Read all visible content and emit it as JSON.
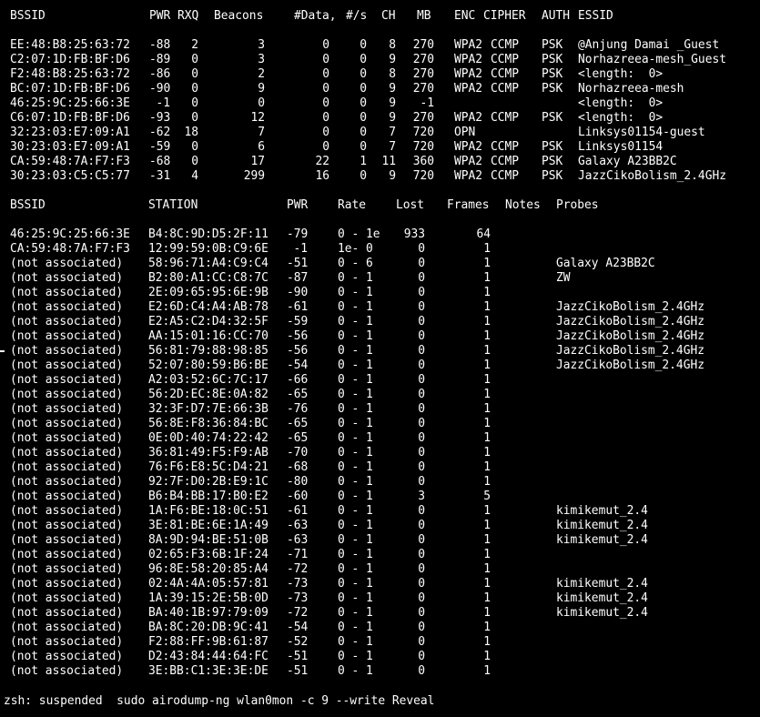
{
  "ap_table": {
    "headers": {
      "bssid": "BSSID",
      "pwr": "PWR",
      "rxq": "RXQ",
      "beacons": "Beacons",
      "data": "#Data,",
      "per_s": "#/s",
      "ch": "CH",
      "mb": "MB",
      "enc": "ENC",
      "cipher": "CIPHER",
      "auth": "AUTH",
      "essid": "ESSID"
    },
    "rows": [
      {
        "bssid": "EE:48:B8:25:63:72",
        "pwr": "-88",
        "rxq": "2",
        "beacons": "3",
        "data": "0",
        "per_s": "0",
        "ch": "8",
        "mb": "270",
        "enc": "WPA2",
        "cipher": "CCMP",
        "auth": "PSK",
        "essid": "@Anjung Damai _Guest"
      },
      {
        "bssid": "C2:07:1D:FB:BF:D6",
        "pwr": "-89",
        "rxq": "0",
        "beacons": "3",
        "data": "0",
        "per_s": "0",
        "ch": "9",
        "mb": "270",
        "enc": "WPA2",
        "cipher": "CCMP",
        "auth": "PSK",
        "essid": "Norhazreea-mesh_Guest"
      },
      {
        "bssid": "F2:48:B8:25:63:72",
        "pwr": "-86",
        "rxq": "0",
        "beacons": "2",
        "data": "0",
        "per_s": "0",
        "ch": "8",
        "mb": "270",
        "enc": "WPA2",
        "cipher": "CCMP",
        "auth": "PSK",
        "essid": "<length:  0>"
      },
      {
        "bssid": "BC:07:1D:FB:BF:D6",
        "pwr": "-90",
        "rxq": "0",
        "beacons": "9",
        "data": "0",
        "per_s": "0",
        "ch": "9",
        "mb": "270",
        "enc": "WPA2",
        "cipher": "CCMP",
        "auth": "PSK",
        "essid": "Norhazreea-mesh"
      },
      {
        "bssid": "46:25:9C:25:66:3E",
        "pwr": "-1",
        "rxq": "0",
        "beacons": "0",
        "data": "0",
        "per_s": "0",
        "ch": "9",
        "mb": "-1",
        "enc": "",
        "cipher": "",
        "auth": "",
        "essid": "<length:  0>"
      },
      {
        "bssid": "C6:07:1D:FB:BF:D6",
        "pwr": "-93",
        "rxq": "0",
        "beacons": "12",
        "data": "0",
        "per_s": "0",
        "ch": "9",
        "mb": "270",
        "enc": "WPA2",
        "cipher": "CCMP",
        "auth": "PSK",
        "essid": "<length:  0>"
      },
      {
        "bssid": "32:23:03:E7:09:A1",
        "pwr": "-62",
        "rxq": "18",
        "beacons": "7",
        "data": "0",
        "per_s": "0",
        "ch": "7",
        "mb": "720",
        "enc": "OPN",
        "cipher": "",
        "auth": "",
        "essid": "Linksys01154-guest"
      },
      {
        "bssid": "30:23:03:E7:09:A1",
        "pwr": "-59",
        "rxq": "0",
        "beacons": "6",
        "data": "0",
        "per_s": "0",
        "ch": "7",
        "mb": "720",
        "enc": "WPA2",
        "cipher": "CCMP",
        "auth": "PSK",
        "essid": "Linksys01154"
      },
      {
        "bssid": "CA:59:48:7A:F7:F3",
        "pwr": "-68",
        "rxq": "0",
        "beacons": "17",
        "data": "22",
        "per_s": "1",
        "ch": "11",
        "mb": "360",
        "enc": "WPA2",
        "cipher": "CCMP",
        "auth": "PSK",
        "essid": "Galaxy A23BB2C"
      },
      {
        "bssid": "30:23:03:C5:C5:77",
        "pwr": "-31",
        "rxq": "4",
        "beacons": "299",
        "data": "16",
        "per_s": "0",
        "ch": "9",
        "mb": "720",
        "enc": "WPA2",
        "cipher": "CCMP",
        "auth": "PSK",
        "essid": "JazzCikoBolism_2.4GHz"
      }
    ]
  },
  "station_table": {
    "headers": {
      "bssid": "BSSID",
      "station": "STATION",
      "pwr": "PWR",
      "rate": "Rate",
      "lost": "Lost",
      "frames": "Frames",
      "notes": "Notes",
      "probes": "Probes"
    },
    "rows": [
      {
        "bssid": "46:25:9C:25:66:3E",
        "station": "B4:8C:9D:D5:2F:11",
        "pwr": "-79",
        "rate": "0 - 1e",
        "lost": "933",
        "frames": "64",
        "probes": ""
      },
      {
        "bssid": "CA:59:48:7A:F7:F3",
        "station": "12:99:59:0B:C9:6E",
        "pwr": "-1",
        "rate": "1e- 0",
        "lost": "0",
        "frames": "1",
        "probes": ""
      },
      {
        "bssid": "(not associated)",
        "station": "58:96:71:A4:C9:C4",
        "pwr": "-51",
        "rate": "0 - 6",
        "lost": "0",
        "frames": "1",
        "probes": "Galaxy A23BB2C"
      },
      {
        "bssid": "(not associated)",
        "station": "B2:80:A1:CC:C8:7C",
        "pwr": "-87",
        "rate": "0 - 1",
        "lost": "0",
        "frames": "1",
        "probes": "ZW"
      },
      {
        "bssid": "(not associated)",
        "station": "2E:09:65:95:6E:9B",
        "pwr": "-90",
        "rate": "0 - 1",
        "lost": "0",
        "frames": "1",
        "probes": ""
      },
      {
        "bssid": "(not associated)",
        "station": "E2:6D:C4:A4:AB:78",
        "pwr": "-61",
        "rate": "0 - 1",
        "lost": "0",
        "frames": "1",
        "probes": "JazzCikoBolism_2.4GHz"
      },
      {
        "bssid": "(not associated)",
        "station": "E2:A5:C2:D4:32:5F",
        "pwr": "-59",
        "rate": "0 - 1",
        "lost": "0",
        "frames": "1",
        "probes": "JazzCikoBolism_2.4GHz"
      },
      {
        "bssid": "(not associated)",
        "station": "AA:15:01:16:CC:70",
        "pwr": "-56",
        "rate": "0 - 1",
        "lost": "0",
        "frames": "1",
        "probes": "JazzCikoBolism_2.4GHz"
      },
      {
        "bssid": "(not associated)",
        "station": "56:81:79:88:98:85",
        "pwr": "-56",
        "rate": "0 - 1",
        "lost": "0",
        "frames": "1",
        "probes": "JazzCikoBolism_2.4GHz"
      },
      {
        "bssid": "(not associated)",
        "station": "52:07:80:59:B6:BE",
        "pwr": "-54",
        "rate": "0 - 1",
        "lost": "0",
        "frames": "1",
        "probes": "JazzCikoBolism_2.4GHz"
      },
      {
        "bssid": "(not associated)",
        "station": "A2:03:52:6C:7C:17",
        "pwr": "-66",
        "rate": "0 - 1",
        "lost": "0",
        "frames": "1",
        "probes": ""
      },
      {
        "bssid": "(not associated)",
        "station": "56:2D:EC:8E:0A:82",
        "pwr": "-65",
        "rate": "0 - 1",
        "lost": "0",
        "frames": "1",
        "probes": ""
      },
      {
        "bssid": "(not associated)",
        "station": "32:3F:D7:7E:66:3B",
        "pwr": "-76",
        "rate": "0 - 1",
        "lost": "0",
        "frames": "1",
        "probes": ""
      },
      {
        "bssid": "(not associated)",
        "station": "56:8E:F8:36:84:BC",
        "pwr": "-65",
        "rate": "0 - 1",
        "lost": "0",
        "frames": "1",
        "probes": ""
      },
      {
        "bssid": "(not associated)",
        "station": "0E:0D:40:74:22:42",
        "pwr": "-65",
        "rate": "0 - 1",
        "lost": "0",
        "frames": "1",
        "probes": ""
      },
      {
        "bssid": "(not associated)",
        "station": "36:81:49:F5:F9:AB",
        "pwr": "-70",
        "rate": "0 - 1",
        "lost": "0",
        "frames": "1",
        "probes": ""
      },
      {
        "bssid": "(not associated)",
        "station": "76:F6:E8:5C:D4:21",
        "pwr": "-68",
        "rate": "0 - 1",
        "lost": "0",
        "frames": "1",
        "probes": ""
      },
      {
        "bssid": "(not associated)",
        "station": "92:7F:D0:2B:E9:1C",
        "pwr": "-80",
        "rate": "0 - 1",
        "lost": "0",
        "frames": "1",
        "probes": ""
      },
      {
        "bssid": "(not associated)",
        "station": "B6:B4:BB:17:B0:E2",
        "pwr": "-60",
        "rate": "0 - 1",
        "lost": "3",
        "frames": "5",
        "probes": ""
      },
      {
        "bssid": "(not associated)",
        "station": "1A:F6:BE:18:0C:51",
        "pwr": "-61",
        "rate": "0 - 1",
        "lost": "0",
        "frames": "1",
        "probes": "kimikemut_2.4"
      },
      {
        "bssid": "(not associated)",
        "station": "3E:81:BE:6E:1A:49",
        "pwr": "-63",
        "rate": "0 - 1",
        "lost": "0",
        "frames": "1",
        "probes": "kimikemut_2.4"
      },
      {
        "bssid": "(not associated)",
        "station": "8A:9D:94:BE:51:0B",
        "pwr": "-63",
        "rate": "0 - 1",
        "lost": "0",
        "frames": "1",
        "probes": "kimikemut_2.4"
      },
      {
        "bssid": "(not associated)",
        "station": "02:65:F3:6B:1F:24",
        "pwr": "-71",
        "rate": "0 - 1",
        "lost": "0",
        "frames": "1",
        "probes": ""
      },
      {
        "bssid": "(not associated)",
        "station": "96:8E:58:20:85:A4",
        "pwr": "-72",
        "rate": "0 - 1",
        "lost": "0",
        "frames": "1",
        "probes": ""
      },
      {
        "bssid": "(not associated)",
        "station": "02:4A:4A:05:57:81",
        "pwr": "-73",
        "rate": "0 - 1",
        "lost": "0",
        "frames": "1",
        "probes": "kimikemut_2.4"
      },
      {
        "bssid": "(not associated)",
        "station": "1A:39:15:2E:5B:0D",
        "pwr": "-73",
        "rate": "0 - 1",
        "lost": "0",
        "frames": "1",
        "probes": "kimikemut_2.4"
      },
      {
        "bssid": "(not associated)",
        "station": "BA:40:1B:97:79:09",
        "pwr": "-72",
        "rate": "0 - 1",
        "lost": "0",
        "frames": "1",
        "probes": "kimikemut_2.4"
      },
      {
        "bssid": "(not associated)",
        "station": "BA:8C:20:DB:9C:41",
        "pwr": "-54",
        "rate": "0 - 1",
        "lost": "0",
        "frames": "1",
        "probes": ""
      },
      {
        "bssid": "(not associated)",
        "station": "F2:88:FF:9B:61:87",
        "pwr": "-52",
        "rate": "0 - 1",
        "lost": "0",
        "frames": "1",
        "probes": ""
      },
      {
        "bssid": "(not associated)",
        "station": "D2:43:84:44:64:FC",
        "pwr": "-51",
        "rate": "0 - 1",
        "lost": "0",
        "frames": "1",
        "probes": ""
      },
      {
        "bssid": "(not associated)",
        "station": "3E:BB:C1:3E:3E:DE",
        "pwr": "-51",
        "rate": "0 - 1",
        "lost": "0",
        "frames": "1",
        "probes": ""
      }
    ]
  },
  "prompt": {
    "text": "zsh: suspended  sudo airodump-ng wlan0mon -c 9 --write Reveal"
  },
  "colors": {
    "background": "#000000",
    "foreground": "#ffffff"
  }
}
